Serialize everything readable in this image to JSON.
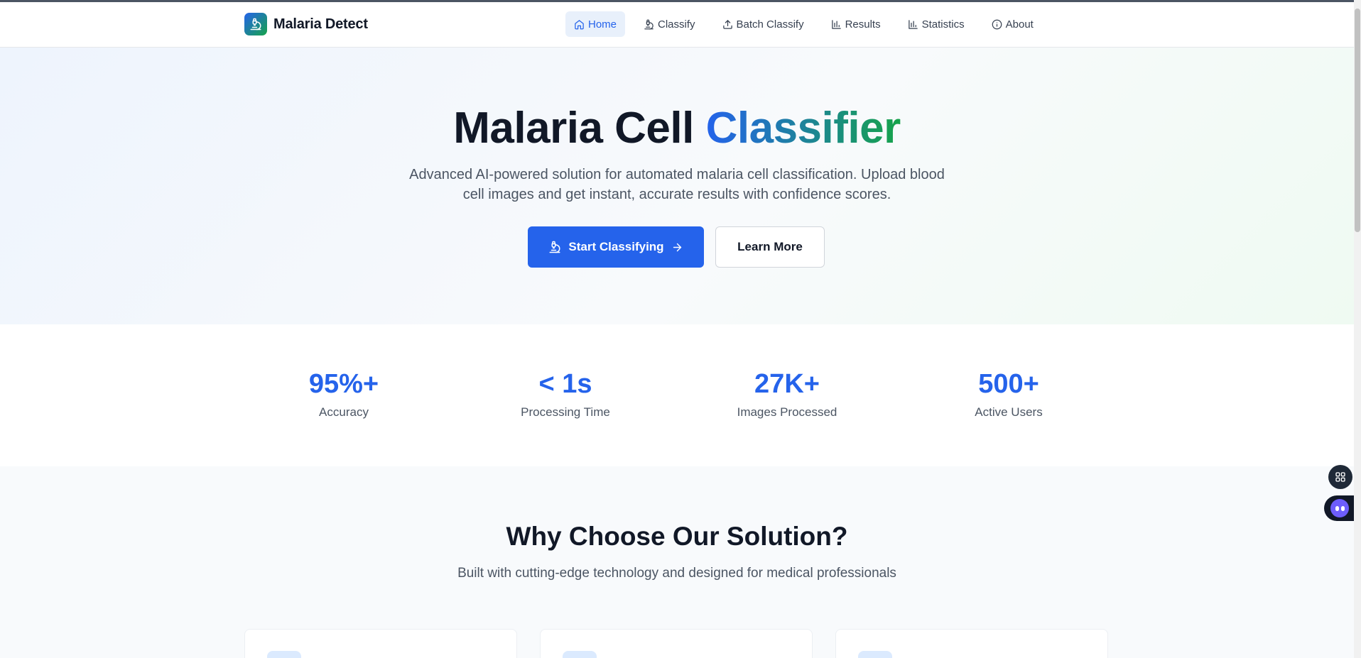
{
  "brand": {
    "name": "Malaria Detect",
    "icon": "microscope-icon"
  },
  "nav": {
    "items": [
      {
        "label": "Home",
        "icon": "home-icon",
        "active": true
      },
      {
        "label": "Classify",
        "icon": "microscope-icon",
        "active": false
      },
      {
        "label": "Batch Classify",
        "icon": "upload-icon",
        "active": false
      },
      {
        "label": "Results",
        "icon": "bar-chart-icon",
        "active": false
      },
      {
        "label": "Statistics",
        "icon": "bar-chart-icon",
        "active": false
      },
      {
        "label": "About",
        "icon": "info-icon",
        "active": false
      }
    ]
  },
  "hero": {
    "title_part1": "Malaria Cell",
    "title_part2": "Classifier",
    "subtitle": "Advanced AI-powered solution for automated malaria cell classification. Upload blood cell images and get instant, accurate results with confidence scores.",
    "primary_button": "Start Classifying",
    "secondary_button": "Learn More"
  },
  "stats": [
    {
      "value": "95%+",
      "label": "Accuracy"
    },
    {
      "value": "< 1s",
      "label": "Processing Time"
    },
    {
      "value": "27K+",
      "label": "Images Processed"
    },
    {
      "value": "500+",
      "label": "Active Users"
    }
  ],
  "why": {
    "title": "Why Choose Our Solution?",
    "subtitle": "Built with cutting-edge technology and designed for medical professionals"
  },
  "colors": {
    "primary": "#2563eb",
    "accent_green": "#16a34a",
    "text_dark": "#111827",
    "text_muted": "#4b5563"
  }
}
